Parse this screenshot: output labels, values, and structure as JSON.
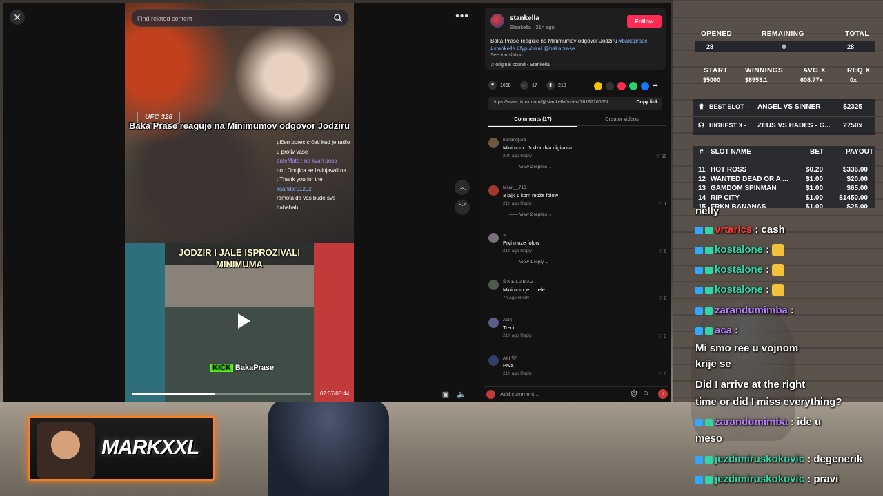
{
  "tiktok": {
    "search_placeholder": "Find related content",
    "video": {
      "caption_top": "Baka Prase reaguje na Minimumov odgovor Jodziru",
      "caption_bottom": "JODZIR I JALE ISPROZIVALI MINIMUMA",
      "ufc_label": "UFC 328",
      "kick_badge": "KICK",
      "kick_name": "BakaPrase",
      "time": "02:37/05:44",
      "progress": 0.46,
      "chat_overlay": [
        {
          "text": "pičen borec crčeti kad je radio",
          "cls": ""
        },
        {
          "text": "u protiv vase",
          "cls": ""
        },
        {
          "text": "euteMato : ne kvari poso",
          "cls": "p"
        },
        {
          "text": "oo : Obojica se izvinjavali na",
          "cls": ""
        },
        {
          "text": "",
          "cls": ""
        },
        {
          "text": ": Thank you for the",
          "cls": ""
        },
        {
          "text": "ksandar01292",
          "cls": "b"
        },
        {
          "text": "ramota da vas bude sve",
          "cls": ""
        },
        {
          "text": "",
          "cls": ""
        },
        {
          "text": "hahahah",
          "cls": ""
        }
      ]
    },
    "author": {
      "name": "stankella",
      "sub": "Stankella · 21h ago",
      "follow": "Follow",
      "desc_text": "Baka Prase reaguje na Minimumov odgovor Jodziru",
      "desc_tags": [
        "#bakaprase",
        "#stankella",
        "#fyp",
        "#viral",
        "@bakaprase"
      ],
      "see_translation": "See translation",
      "sound": "♫ original sound - Stankella"
    },
    "actions": {
      "likes": "1668",
      "comments": "17",
      "saves": "218"
    },
    "link": {
      "url": "https://www.tiktok.com/@stankella/video/7618726555I...",
      "copy": "Copy link"
    },
    "tabs": {
      "comments": "Comments (17)",
      "creator": "Creator videos"
    },
    "comments": [
      {
        "name": "nenaodjuka",
        "text": "Minimum i Jodzir dva digitalca",
        "meta": "20h ago   Reply",
        "likes": "♡ 60",
        "replies": "—— View 2 replies ⌄"
      },
      {
        "name": "Milan__716",
        "text": "3 lajk 1 kom može folow",
        "meta": "21h ago   Reply",
        "likes": "♡ 1",
        "replies": "—— View 2 replies ⌄"
      },
      {
        "name": "✎",
        "text": "Prvi moze folow",
        "meta": "21h ago   Reply",
        "likes": "♡ 0",
        "replies": "—— View 1 reply ⌄"
      },
      {
        "name": "Š K E L J B A Z",
        "text": "Minimum je ... tele",
        "meta": "7h ago   Reply",
        "likes": "♡ 0",
        "replies": ""
      },
      {
        "name": "Adin",
        "text": "Treci",
        "meta": "21h ago   Reply",
        "likes": "♡ 0",
        "replies": ""
      },
      {
        "name": "AKI 🖤",
        "text": "Prva",
        "meta": "21h ago   Reply",
        "likes": "♡ 0",
        "replies": ""
      }
    ],
    "add_comment_placeholder": "Add comment..."
  },
  "stats": {
    "opened_label": "OPENED",
    "remaining_label": "REMAINING",
    "total_label": "TOTAL",
    "opened": "28",
    "remaining": "0",
    "total": "28",
    "start_label": "START",
    "winnings_label": "WINNINGS",
    "avg_label": "AVG X",
    "req_label": "REQ X",
    "start": "$5000",
    "winnings": "$8953.1",
    "avg": "608.77x",
    "req": "0x",
    "best_slot_label": "BEST SLOT -",
    "best_slot_name": "ANGEL VS SINNER",
    "best_slot_value": "$2325",
    "highest_label": "HIGHEST X -",
    "highest_name": "ZEUS VS HADES - G...",
    "highest_value": "2750x",
    "table_headers": {
      "num": "#",
      "name": "SLOT NAME",
      "bet": "BET",
      "payout": "PAYOUT"
    },
    "slots": [
      {
        "num": "11",
        "name": "HOT ROSS",
        "bet": "$0.20",
        "payout": "$336.00"
      },
      {
        "num": "12",
        "name": "WANTED DEAD OR A ...",
        "bet": "$1.00",
        "payout": "$20.00"
      },
      {
        "num": "13",
        "name": "GAMDOM SPINMAN",
        "bet": "$1.00",
        "payout": "$65.00"
      },
      {
        "num": "14",
        "name": "RIP CITY",
        "bet": "$1.00",
        "payout": "$1450.00"
      },
      {
        "num": "15",
        "name": "FRKN BANANAS",
        "bet": "$1.00",
        "payout": "$25.00"
      }
    ]
  },
  "chat": [
    {
      "user": "",
      "text": "nelly",
      "color": "#ffffff"
    },
    {
      "user": "vrtarics",
      "text": ": cash",
      "color": "#ff3b3b"
    },
    {
      "user": "kostalone",
      "text": ":",
      "color": "#2fd6a8"
    },
    {
      "user": "kostalone",
      "text": ":",
      "color": "#2fd6a8"
    },
    {
      "user": "kostalone",
      "text": ":",
      "color": "#2fd6a8"
    },
    {
      "user": "zarandumimba",
      "text": ":",
      "color": "#b87cff"
    },
    {
      "user": "aca",
      "text": ":",
      "color": "#b87cff"
    },
    {
      "user": "",
      "text": "Mi smo ree u vojnom",
      "color": "#ffffff"
    },
    {
      "user": "",
      "text": "krije se",
      "color": "#ffffff"
    },
    {
      "user": "",
      "text": "Did I arrive at the right",
      "color": "#ffffff"
    },
    {
      "user": "",
      "text": "time or did I miss everything?",
      "color": "#ffffff"
    },
    {
      "user": "zarandumimba",
      "text": ": ide u",
      "color": "#b87cff"
    },
    {
      "user": "",
      "text": "meso",
      "color": "#ffffff"
    },
    {
      "user": "jezdimiruskokovic",
      "text": ": degenerik",
      "color": "#2fd6a8"
    },
    {
      "user": "jezdimiruskokovic",
      "text": ": pravi",
      "color": "#2fd6a8"
    }
  ],
  "logo": {
    "text": "MARKXXL"
  }
}
